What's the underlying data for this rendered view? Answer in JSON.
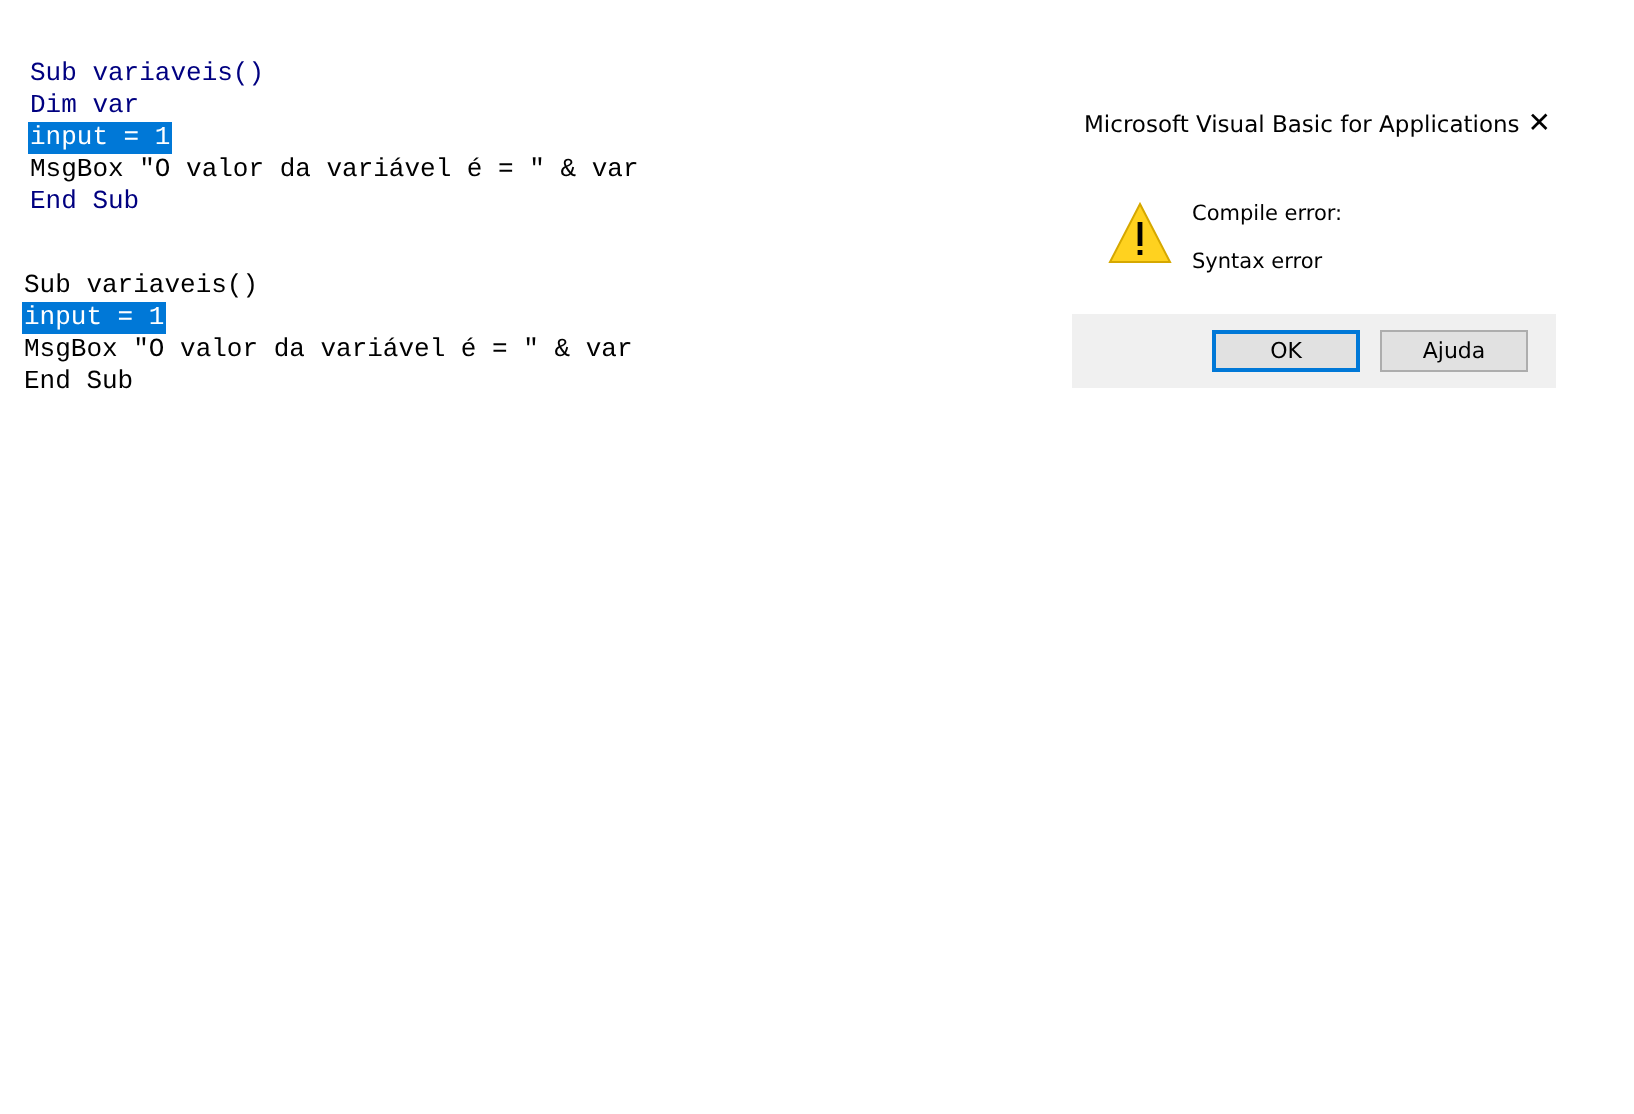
{
  "code_blocks": [
    {
      "lines": [
        {
          "text": "Sub variaveis()",
          "selected": false,
          "color": "#000080"
        },
        {
          "text": "Dim var",
          "selected": false,
          "color": "#000080"
        },
        {
          "text": "input = 1",
          "selected": true
        },
        {
          "text": "MsgBox \"O valor da variável é = \" & var",
          "selected": false,
          "color": "#000000"
        },
        {
          "text": "End Sub",
          "selected": false,
          "color": "#000080"
        }
      ]
    },
    {
      "lines": [
        {
          "text": "Sub variaveis()",
          "selected": false,
          "color": "#000000"
        },
        {
          "text": "input = 1",
          "selected": true
        },
        {
          "text": "MsgBox \"O valor da variável é = \" & var",
          "selected": false,
          "color": "#000000"
        },
        {
          "text": "End Sub",
          "selected": false,
          "color": "#000000"
        }
      ]
    }
  ],
  "dialog": {
    "title": "Microsoft Visual Basic for Applications",
    "close": "✕",
    "heading": "Compile error:",
    "message": "Syntax error",
    "buttons": [
      {
        "label": "OK",
        "selected": true
      },
      {
        "label": "Ajuda",
        "selected": false
      }
    ]
  }
}
